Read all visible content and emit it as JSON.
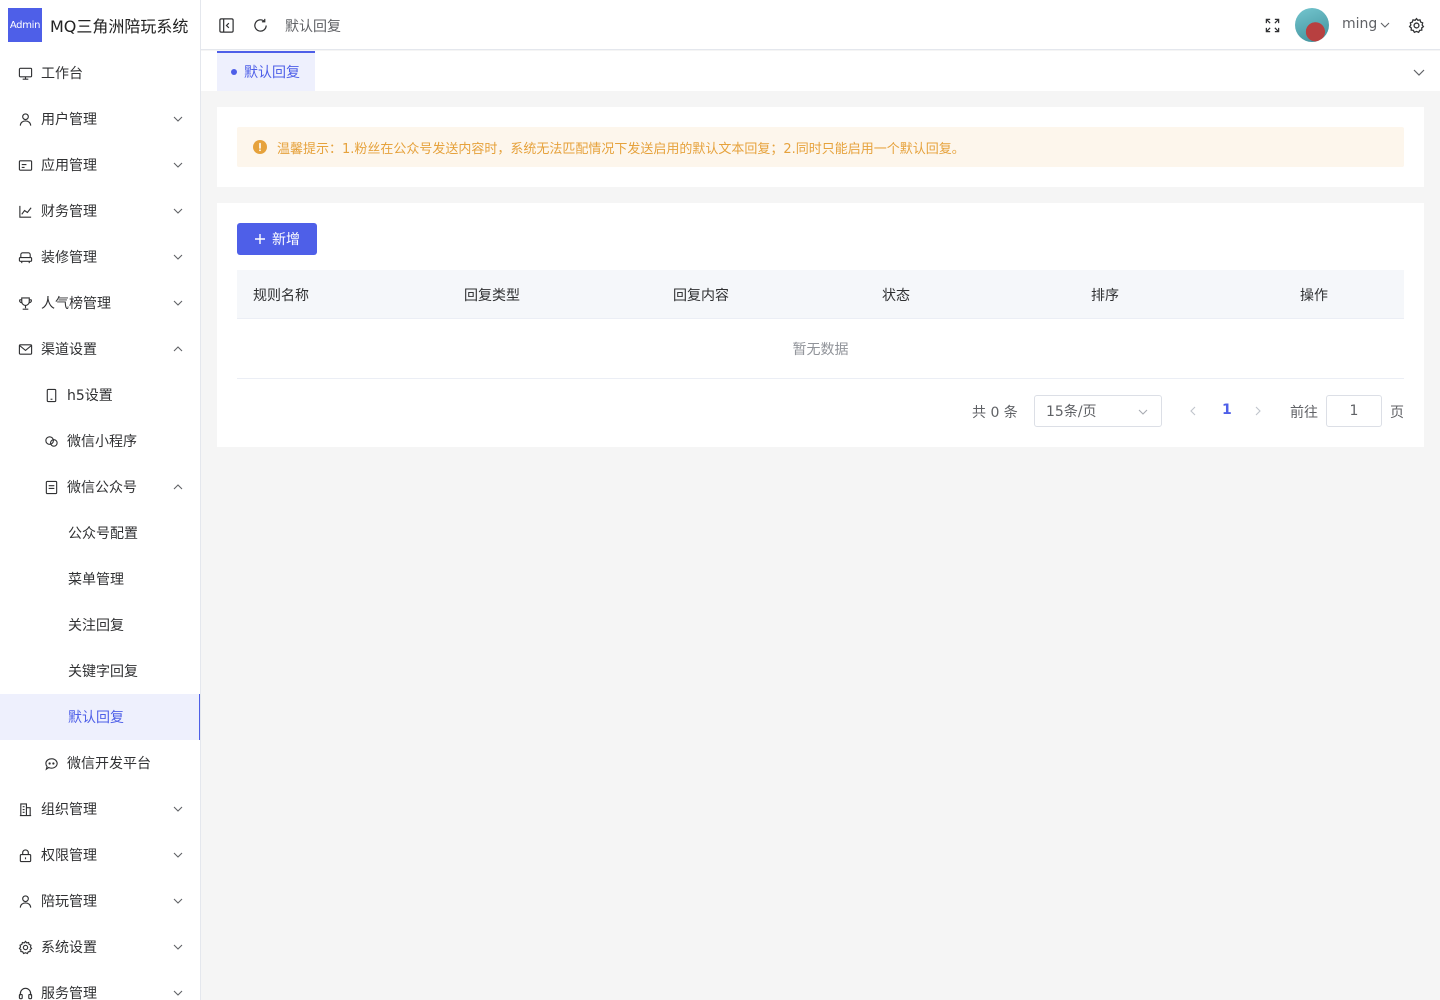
{
  "app": {
    "badge": "Admin",
    "title": "MQ三角洲陪玩系统"
  },
  "sidebar": {
    "items": [
      {
        "label": "工作台",
        "icon": "monitor-icon"
      },
      {
        "label": "用户管理",
        "icon": "user-icon"
      },
      {
        "label": "应用管理",
        "icon": "card-icon"
      },
      {
        "label": "财务管理",
        "icon": "chart-icon"
      },
      {
        "label": "装修管理",
        "icon": "sofa-icon"
      },
      {
        "label": "人气榜管理",
        "icon": "trophy-icon"
      },
      {
        "label": "渠道设置",
        "icon": "message-icon"
      },
      {
        "label": "h5设置",
        "icon": "cellphone-icon"
      },
      {
        "label": "微信小程序",
        "icon": "chat-icon"
      },
      {
        "label": "微信公众号",
        "icon": "document-icon"
      },
      {
        "label": "公众号配置"
      },
      {
        "label": "菜单管理"
      },
      {
        "label": "关注回复"
      },
      {
        "label": "关键字回复"
      },
      {
        "label": "默认回复"
      },
      {
        "label": "微信开发平台",
        "icon": "chat-dot-icon"
      },
      {
        "label": "组织管理",
        "icon": "office-building-icon"
      },
      {
        "label": "权限管理",
        "icon": "lock-icon"
      },
      {
        "label": "陪玩管理",
        "icon": "user-icon"
      },
      {
        "label": "系统设置",
        "icon": "setting-icon"
      },
      {
        "label": "服务管理",
        "icon": "headset-icon"
      }
    ]
  },
  "header": {
    "breadcrumb": "默认回复",
    "username": "ming"
  },
  "tabs": {
    "active": "默认回复"
  },
  "alert": {
    "text": "温馨提示：1.粉丝在公众号发送内容时，系统无法匹配情况下发送启用的默认文本回复；2.同时只能启用一个默认回复。"
  },
  "toolbar": {
    "add_label": "新增"
  },
  "table": {
    "columns": [
      "规则名称",
      "回复类型",
      "回复内容",
      "状态",
      "排序",
      "操作"
    ],
    "empty_text": "暂无数据"
  },
  "pagination": {
    "total_text": "共 0 条",
    "page_size": "15条/页",
    "current_page": "1",
    "goto_label": "前往",
    "goto_value": "1",
    "goto_suffix": "页"
  },
  "colors": {
    "primary": "#4e5fe8",
    "warning": "#e6a23c",
    "warning_bg": "#fdf6ec"
  }
}
